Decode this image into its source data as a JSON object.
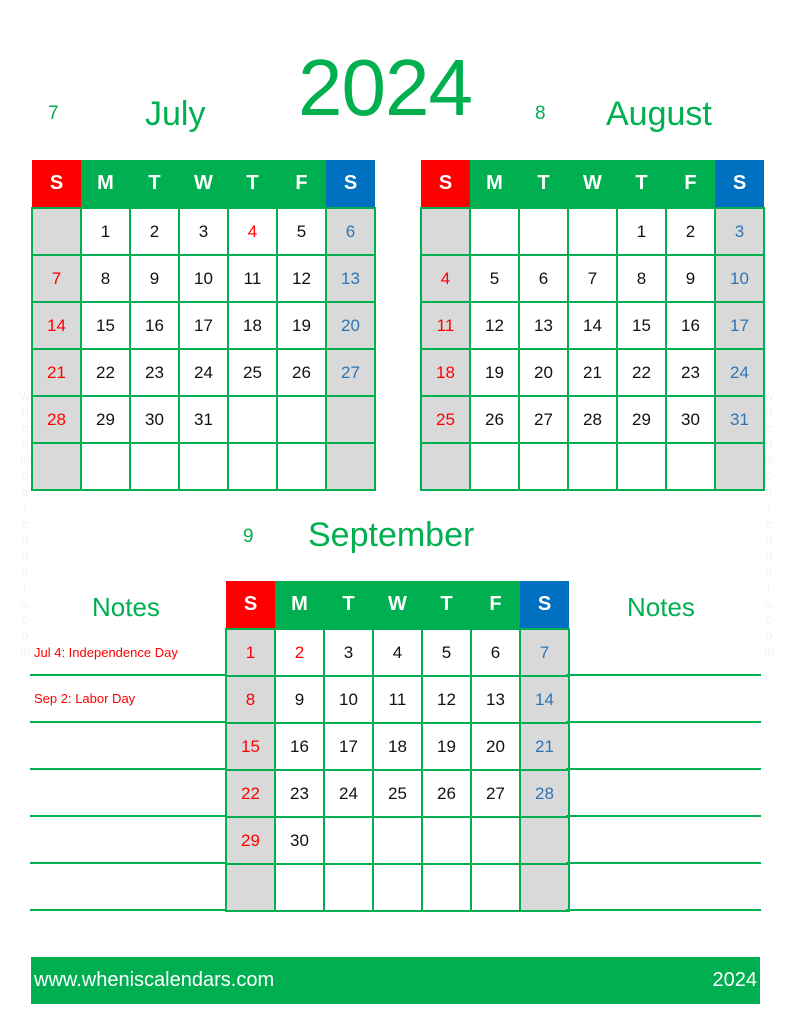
{
  "year": "2024",
  "weekday_headers": [
    "S",
    "M",
    "T",
    "W",
    "T",
    "F",
    "S"
  ],
  "months": [
    {
      "number": "7",
      "name": "July",
      "weeks": [
        [
          "",
          "1",
          "2",
          "3",
          "4",
          "5",
          "6"
        ],
        [
          "7",
          "8",
          "9",
          "10",
          "11",
          "12",
          "13"
        ],
        [
          "14",
          "15",
          "16",
          "17",
          "18",
          "19",
          "20"
        ],
        [
          "21",
          "22",
          "23",
          "24",
          "25",
          "26",
          "27"
        ],
        [
          "28",
          "29",
          "30",
          "31",
          "",
          "",
          ""
        ],
        [
          "",
          "",
          "",
          "",
          "",
          "",
          ""
        ]
      ],
      "holidays": [
        "4"
      ]
    },
    {
      "number": "8",
      "name": "August",
      "weeks": [
        [
          "",
          "",
          "",
          "",
          "1",
          "2",
          "3"
        ],
        [
          "4",
          "5",
          "6",
          "7",
          "8",
          "9",
          "10"
        ],
        [
          "11",
          "12",
          "13",
          "14",
          "15",
          "16",
          "17"
        ],
        [
          "18",
          "19",
          "20",
          "21",
          "22",
          "23",
          "24"
        ],
        [
          "25",
          "26",
          "27",
          "28",
          "29",
          "30",
          "31"
        ],
        [
          "",
          "",
          "",
          "",
          "",
          "",
          ""
        ]
      ],
      "holidays": []
    },
    {
      "number": "9",
      "name": "September",
      "weeks": [
        [
          "1",
          "2",
          "3",
          "4",
          "5",
          "6",
          "7"
        ],
        [
          "8",
          "9",
          "10",
          "11",
          "12",
          "13",
          "14"
        ],
        [
          "15",
          "16",
          "17",
          "18",
          "19",
          "20",
          "21"
        ],
        [
          "22",
          "23",
          "24",
          "25",
          "26",
          "27",
          "28"
        ],
        [
          "29",
          "30",
          "",
          "",
          "",
          "",
          ""
        ],
        [
          "",
          "",
          "",
          "",
          "",
          "",
          ""
        ]
      ],
      "holidays": [
        "2"
      ]
    }
  ],
  "notes": {
    "left_title": "Notes",
    "right_title": "Notes",
    "entries": [
      "Jul 4: Independence Day",
      "Sep 2: Labor Day"
    ]
  },
  "footer": {
    "website": "www.wheniscalendars.com",
    "year": "2024"
  },
  "watermark": "wheniscalendars.com",
  "colors": {
    "brand_green": "#00b050",
    "sunday_red": "#ff0000",
    "saturday_blue": "#0070c0",
    "weekend_gray": "#d9d9d9"
  }
}
